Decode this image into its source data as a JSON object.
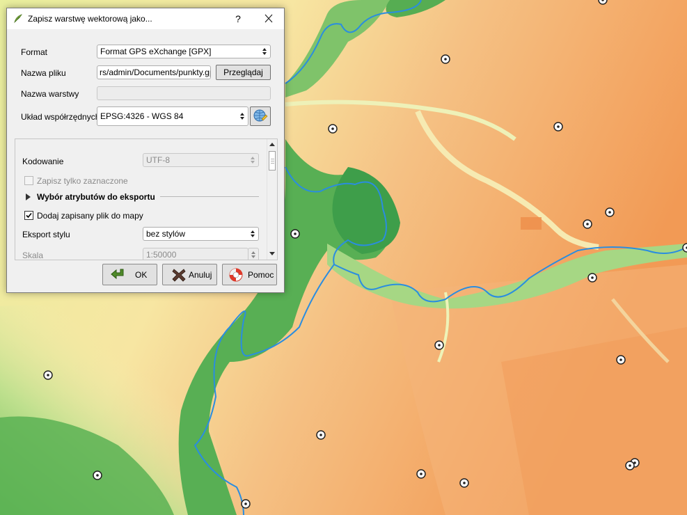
{
  "dialog": {
    "title": "Zapisz warstwę wektorową jako...",
    "help_label": "?",
    "format_label": "Format",
    "format_value": "Format GPS eXchange [GPX]",
    "filename_label": "Nazwa pliku",
    "filename_value": "rs/admin/Documents/punkty.gpx",
    "browse_label": "Przeglądaj",
    "layername_label": "Nazwa warstwy",
    "layername_value": "",
    "crs_label": "Układ współrzędnych",
    "crs_value": "EPSG:4326 - WGS 84",
    "encoding_label": "Kodowanie",
    "encoding_value": "UTF-8",
    "save_selected_label": "Zapisz tylko zaznaczone",
    "attributes_section": "Wybór atrybutów do eksportu",
    "add_to_map_label": "Dodaj zapisany plik do mapy",
    "style_export_label": "Eksport stylu",
    "style_export_value": "bez stylów",
    "scale_label": "Skala",
    "scale_value": "1:50000",
    "ok_label": "OK",
    "cancel_label": "Anuluj",
    "help_button_label": "Pomoc"
  },
  "state": {
    "save_selected_checked": false,
    "add_to_map_checked": true
  },
  "map": {
    "point_markers_count": 22
  }
}
